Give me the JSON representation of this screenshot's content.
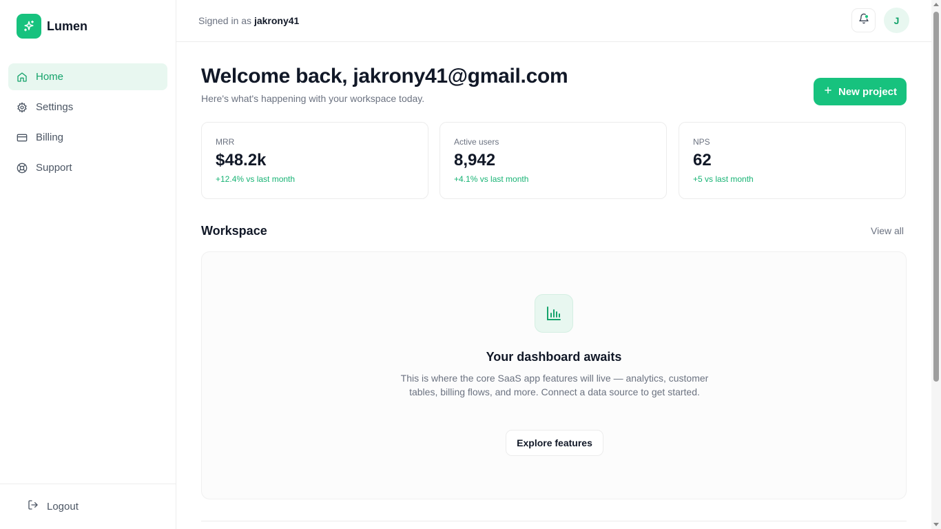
{
  "brand": {
    "name": "Lumen",
    "logo_icon": "sparkles-icon",
    "accent": "#17c27e"
  },
  "sidebar": {
    "items": [
      {
        "label": "Home",
        "icon": "home-icon",
        "active": true
      },
      {
        "label": "Settings",
        "icon": "gear-icon",
        "active": false
      },
      {
        "label": "Billing",
        "icon": "credit-card-icon",
        "active": false
      },
      {
        "label": "Support",
        "icon": "lifebuoy-icon",
        "active": false
      }
    ],
    "logout_label": "Logout"
  },
  "topbar": {
    "signed_in_prefix": "Signed in as",
    "username": "jakrony41",
    "avatar_initial": "J"
  },
  "main": {
    "title": "Welcome back, jakrony41@gmail.com",
    "subtitle": "Here's what's happening with your workspace today.",
    "new_project_label": "New project",
    "stats": [
      {
        "label": "MRR",
        "value": "$48.2k",
        "delta": "+12.4% vs last month"
      },
      {
        "label": "Active users",
        "value": "8,942",
        "delta": "+4.1% vs last month"
      },
      {
        "label": "NPS",
        "value": "62",
        "delta": "+5 vs last month"
      }
    ],
    "workspace": {
      "title": "Workspace",
      "view_all_label": "View all",
      "empty_title": "Your dashboard awaits",
      "empty_text": "This is where the core SaaS app features will live — analytics, customer tables, billing flows, and more. Connect a data source to get started.",
      "explore_label": "Explore features"
    }
  }
}
